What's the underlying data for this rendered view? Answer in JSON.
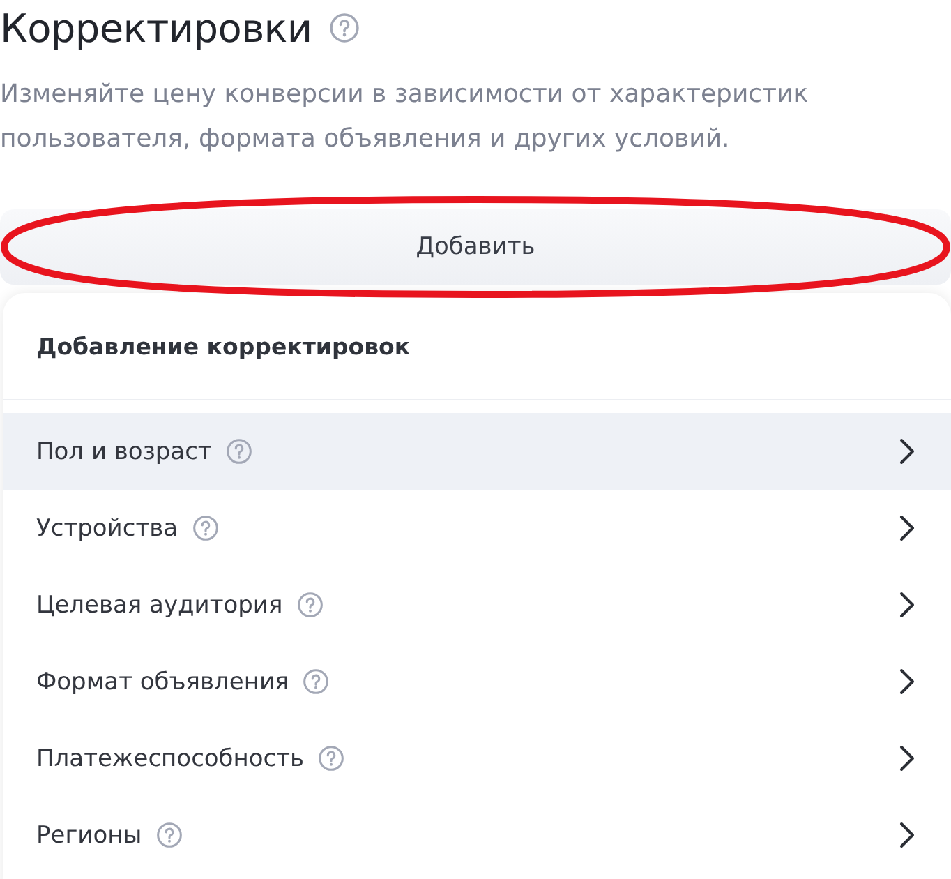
{
  "header": {
    "title": "Корректировки",
    "description": "Изменяйте цену конверсии в зависимости от характеристик пользователя, формата объявления и других условий."
  },
  "add_button": {
    "label": "Добавить",
    "highlighted": true
  },
  "menu": {
    "title": "Добавление корректировок",
    "items": [
      {
        "label": "Пол и возраст",
        "selected": true
      },
      {
        "label": "Устройства",
        "selected": false
      },
      {
        "label": "Целевая аудитория",
        "selected": false
      },
      {
        "label": "Формат объявления",
        "selected": false
      },
      {
        "label": "Платежеспособность",
        "selected": false
      },
      {
        "label": "Регионы",
        "selected": false
      }
    ]
  }
}
